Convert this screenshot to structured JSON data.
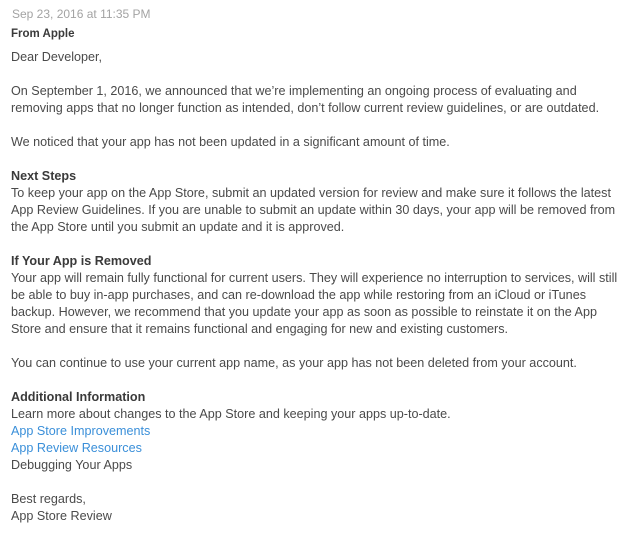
{
  "header": {
    "timestamp": "Sep 23, 2016 at 11:35 PM",
    "sender": "From Apple"
  },
  "body": {
    "greeting": "Dear Developer,",
    "intro": "On September 1, 2016, we announced that we’re implementing an ongoing process of evaluating and removing apps that no longer function as intended, don’t follow current review guidelines, or are outdated.",
    "notice": "We noticed that your app has not been updated in a significant amount of time.",
    "next_steps": {
      "heading": "Next Steps",
      "text": "To keep your app on the App Store, submit an updated version for review and make sure it follows the latest App Review Guidelines. If you are unable to submit an update within 30 days, your app will be removed from the App Store until you submit an update and it is approved."
    },
    "if_removed": {
      "heading": "If Your App is Removed",
      "text": "Your app will remain fully functional for current users. They will experience no interruption to services, will still be able to buy in-app purchases, and can re-download the app while restoring from an iCloud or iTunes backup. However, we recommend that you update your app as soon as possible to reinstate it on the App Store and ensure that it remains functional and engaging for new and existing customers."
    },
    "name_note": "You can continue to use your current app name, as your app has not been deleted from your account.",
    "additional": {
      "heading": "Additional Information",
      "text": "Learn more about changes to the App Store and keeping your apps up-to-date.",
      "link_1": "App Store Improvements",
      "link_2": "App Review Resources",
      "plain_item": "Debugging Your Apps"
    },
    "closing": "Best regards,",
    "signature": "App Store Review"
  },
  "colors": {
    "link": "#3a8fd9",
    "text": "#4a4a4a",
    "timestamp": "#a3a3a3"
  }
}
